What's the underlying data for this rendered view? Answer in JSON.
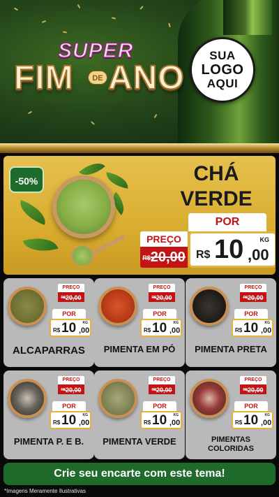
{
  "header": {
    "title_top": "SUPER",
    "title_left": "FIM",
    "title_mid": "DE",
    "title_right": "ANO",
    "logo_lines": [
      "SUA",
      "LOGO",
      "AQUI"
    ]
  },
  "featured": {
    "discount": "-50%",
    "name_line1": "CHÁ",
    "name_line2": "VERDE",
    "price_label": "PREÇO",
    "old_price_currency": "R$",
    "old_price": "20,00",
    "por_label": "POR",
    "new_price_currency": "R$",
    "new_price_int": "10",
    "new_price_dec": ",00",
    "unit": "KG"
  },
  "products": [
    {
      "name": "ALCAPARRAS",
      "price_label": "PREÇO",
      "old_currency": "R$",
      "old_price": "20,00",
      "por_label": "POR",
      "currency": "R$",
      "price_int": "10",
      "price_dec": ",00",
      "unit": "KG"
    },
    {
      "name": "PIMENTA EM PÓ",
      "price_label": "PREÇO",
      "old_currency": "R$",
      "old_price": "20,00",
      "por_label": "POR",
      "currency": "R$",
      "price_int": "10",
      "price_dec": ",00",
      "unit": "KG"
    },
    {
      "name": "PIMENTA PRETA",
      "price_label": "PREÇO",
      "old_currency": "R$",
      "old_price": "20,00",
      "por_label": "POR",
      "currency": "R$",
      "price_int": "10",
      "price_dec": ",00",
      "unit": "KG"
    },
    {
      "name": "PIMENTA P. E B.",
      "price_label": "PREÇO",
      "old_currency": "R$",
      "old_price": "20,00",
      "por_label": "POR",
      "currency": "R$",
      "price_int": "10",
      "price_dec": ",00",
      "unit": "KG"
    },
    {
      "name": "PIMENTA VERDE",
      "price_label": "PREÇO",
      "old_currency": "R$",
      "old_price": "20,00",
      "por_label": "POR",
      "currency": "R$",
      "price_int": "10",
      "price_dec": ",00",
      "unit": "KG"
    },
    {
      "name_line1": "PIMENTAS",
      "name_line2": "COLORIDAS",
      "price_label": "PREÇO",
      "old_currency": "R$",
      "old_price": "20,00",
      "por_label": "POR",
      "currency": "R$",
      "price_int": "10",
      "price_dec": ",00",
      "unit": "KG"
    }
  ],
  "cta": "Crie seu encarte com este tema!",
  "disclaimer": "*Imagens Meramente Ilustrativas",
  "colors": {
    "accent_green": "#1f6b2c",
    "gold": "#e6c04e",
    "price_red": "#c21414",
    "card_gray": "#b9b9b9"
  }
}
